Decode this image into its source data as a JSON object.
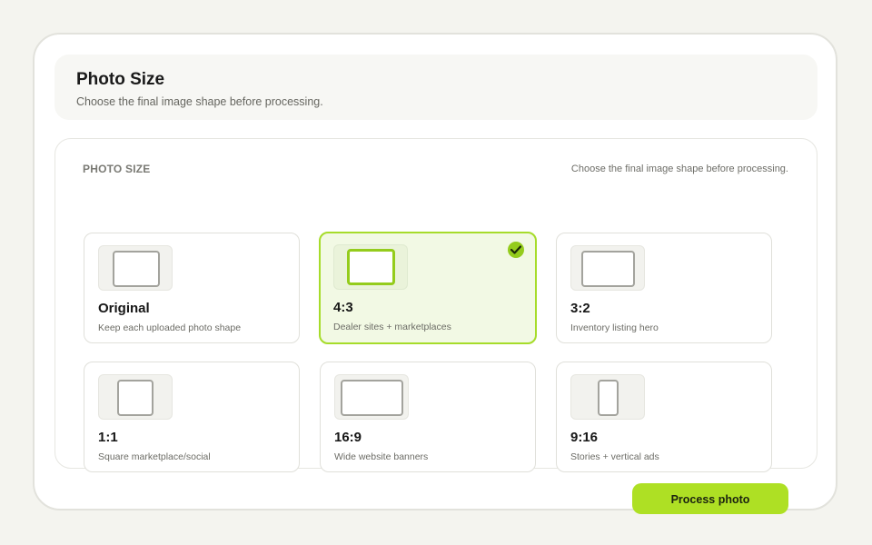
{
  "header": {
    "title": "Photo Size",
    "subtitle": "Choose the final image shape before processing."
  },
  "panel": {
    "label": "PHOTO SIZE",
    "hint": "Choose the final image shape before processing."
  },
  "options": [
    {
      "title": "Original",
      "description": "Keep each uploaded photo shape",
      "selected": false
    },
    {
      "title": "4:3",
      "description": "Dealer sites + marketplaces",
      "selected": true
    },
    {
      "title": "3:2",
      "description": "Inventory listing hero",
      "selected": false
    },
    {
      "title": "1:1",
      "description": "Square marketplace/social",
      "selected": false
    },
    {
      "title": "16:9",
      "description": "Wide website banners",
      "selected": false
    },
    {
      "title": "9:16",
      "description": "Stories + vertical ads",
      "selected": false
    }
  ],
  "actions": {
    "process_label": "Process photo"
  },
  "colors": {
    "accent": "#aee024",
    "selected_border": "#a6dc2a",
    "selected_bg": "#f2f9e4"
  },
  "icons": {
    "check": "check-icon"
  }
}
